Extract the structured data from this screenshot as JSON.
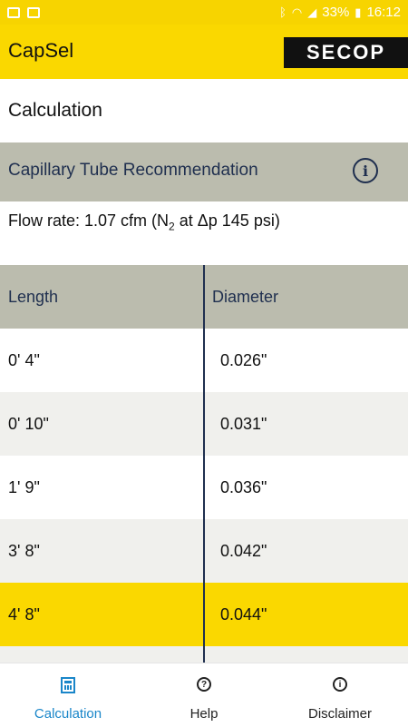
{
  "status": {
    "battery": "33%",
    "time": "16:12",
    "icons": [
      "image-icon",
      "mail-icon",
      "bluetooth-icon",
      "wifi-icon",
      "signal-icon",
      "battery-icon"
    ]
  },
  "appbar": {
    "title": "CapSel",
    "logo": "SECOP"
  },
  "section": {
    "title": "Calculation"
  },
  "recommendation": {
    "label": "Capillary Tube Recommendation",
    "info_icon": "info-icon"
  },
  "flow": {
    "prefix": "Flow rate: 1.07 cfm (N",
    "subscript": "2",
    "suffix": " at Δp 145 psi)"
  },
  "table": {
    "headers": [
      "Length",
      "Diameter"
    ],
    "rows": [
      {
        "length": "0' 4\"",
        "diameter": "0.026\""
      },
      {
        "length": "0' 10\"",
        "diameter": "0.031\""
      },
      {
        "length": "1' 9\"",
        "diameter": "0.036\""
      },
      {
        "length": "3' 8\"",
        "diameter": "0.042\""
      },
      {
        "length": "4' 8\"",
        "diameter": "0.044\""
      }
    ],
    "selected_row": 4
  },
  "colors": {
    "accent": "#fad800",
    "header_gray": "#bbbcae",
    "navy": "#1f2f4f",
    "active_blue": "#1a86c9"
  },
  "nav": {
    "items": [
      {
        "label": "Calculation",
        "icon": "calculator-icon",
        "active": true
      },
      {
        "label": "Help",
        "icon": "help-icon",
        "active": false
      },
      {
        "label": "Disclaimer",
        "icon": "info-icon",
        "active": false
      }
    ]
  }
}
